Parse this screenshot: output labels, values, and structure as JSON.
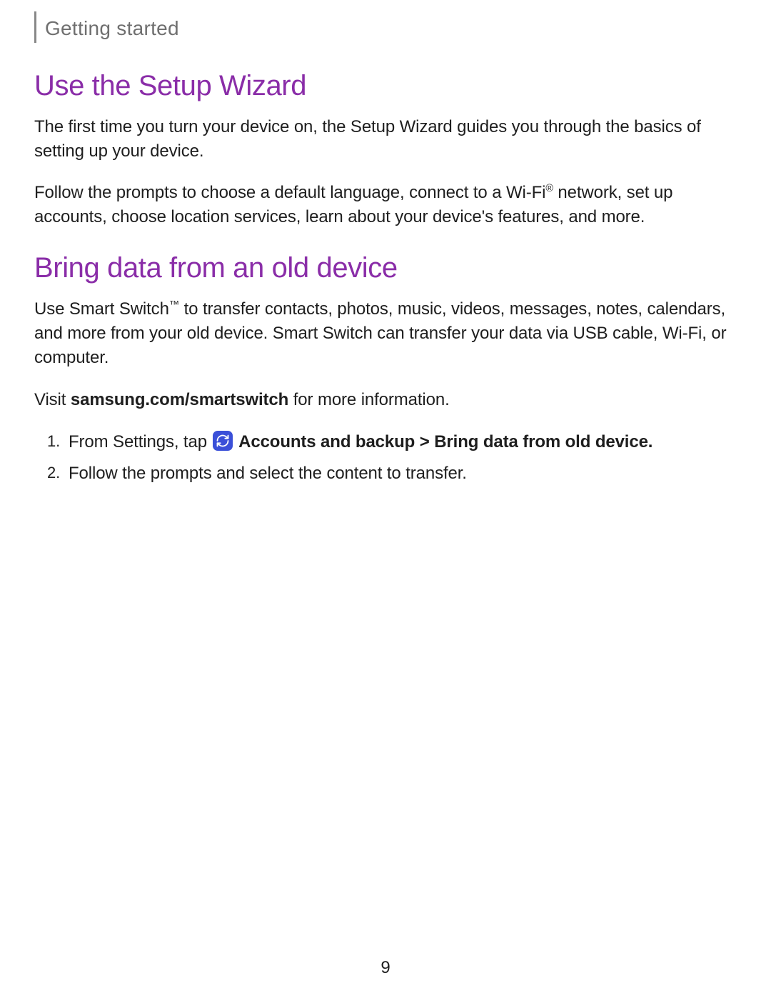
{
  "header": {
    "section_label": "Getting started"
  },
  "section1": {
    "heading": "Use the Setup Wizard",
    "para1": "The first time you turn your device on, the Setup Wizard guides you through the basics of setting up your device.",
    "para2_pre": "Follow the prompts to choose a default language, connect to a Wi-Fi",
    "para2_sup": "®",
    "para2_post": " network, set up accounts, choose location services, learn about your device's features, and more."
  },
  "section2": {
    "heading": "Bring data from an old device",
    "para1_pre": "Use Smart Switch",
    "para1_sup": "™",
    "para1_post": " to transfer contacts, photos, music, videos, messages, notes, calendars, and more from your old device. Smart Switch can transfer your data via USB cable, Wi-Fi, or computer.",
    "para2_pre": "Visit ",
    "para2_link": "samsung.com/smartswitch",
    "para2_post": " for more information.",
    "steps": {
      "s1_pre": "From Settings, tap ",
      "s1_bold": " Accounts and backup > Bring data from old device.",
      "s2": "Follow the prompts and select the content to transfer."
    }
  },
  "page_number": "9"
}
